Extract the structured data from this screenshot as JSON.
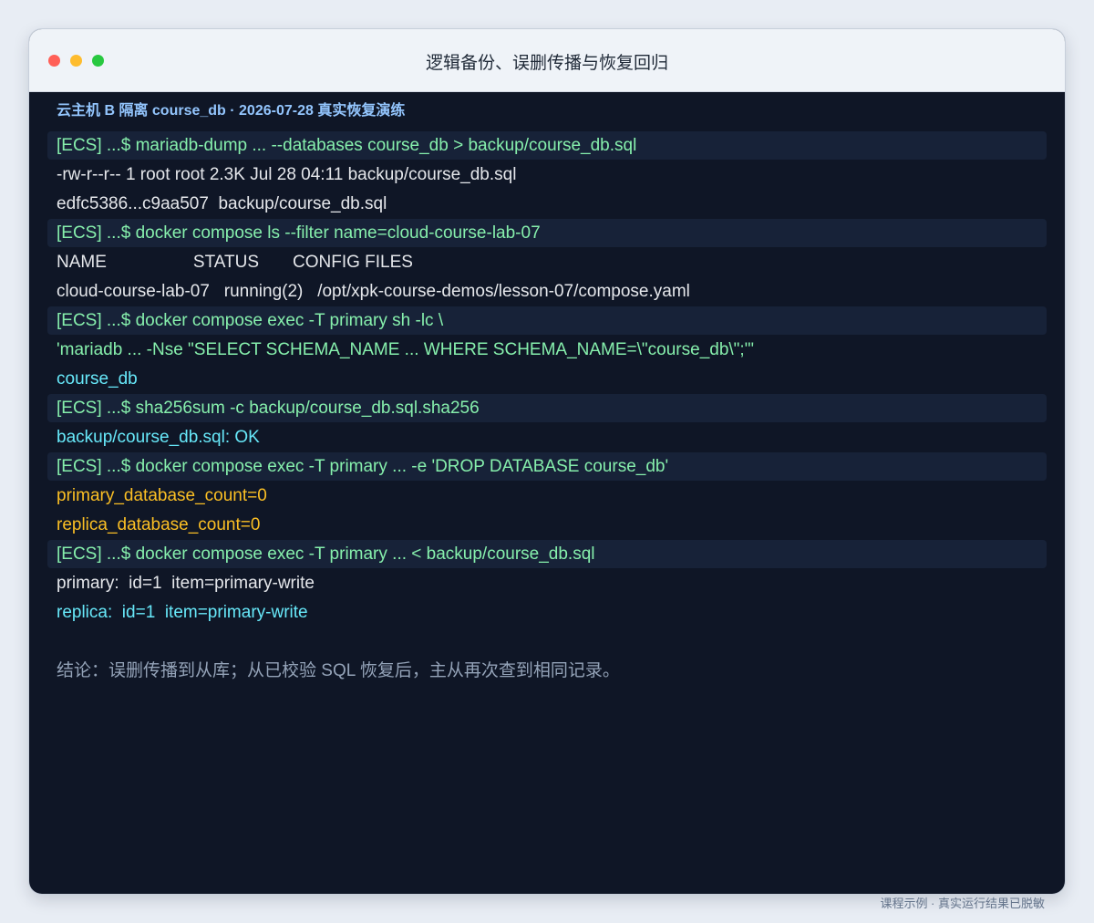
{
  "window": {
    "title": "逻辑备份、误删传播与恢复回归"
  },
  "terminal": {
    "header": "云主机 B 隔离 course_db · 2026-07-28 真实恢复演练",
    "lines": [
      {
        "kind": "cmd",
        "text": "[ECS] ...$ mariadb-dump ... --databases course_db > backup/course_db.sql"
      },
      {
        "kind": "white",
        "text": "-rw-r--r-- 1 root root 2.3K Jul 28 04:11 backup/course_db.sql"
      },
      {
        "kind": "white",
        "text": "edfc5386...c9aa507  backup/course_db.sql"
      },
      {
        "kind": "cmd",
        "text": "[ECS] ...$ docker compose ls --filter name=cloud-course-lab-07"
      },
      {
        "kind": "white",
        "text": "NAME                  STATUS       CONFIG FILES"
      },
      {
        "kind": "white",
        "text": "cloud-course-lab-07   running(2)   /opt/xpk-course-demos/lesson-07/compose.yaml"
      },
      {
        "kind": "cmd",
        "text": "[ECS] ...$ docker compose exec -T primary sh -lc \\"
      },
      {
        "kind": "green",
        "text": "'mariadb ... -Nse \"SELECT SCHEMA_NAME ... WHERE SCHEMA_NAME=\\\"course_db\\\";\"'"
      },
      {
        "kind": "cyan",
        "text": "course_db"
      },
      {
        "kind": "cmd",
        "text": "[ECS] ...$ sha256sum -c backup/course_db.sql.sha256"
      },
      {
        "kind": "cyan",
        "text": "backup/course_db.sql: OK"
      },
      {
        "kind": "cmd",
        "text": "[ECS] ...$ docker compose exec -T primary ... -e 'DROP DATABASE course_db'"
      },
      {
        "kind": "amber",
        "text": "primary_database_count=0"
      },
      {
        "kind": "amber",
        "text": "replica_database_count=0"
      },
      {
        "kind": "cmd",
        "text": "[ECS] ...$ docker compose exec -T primary ... < backup/course_db.sql"
      },
      {
        "kind": "white",
        "text": "primary:  id=1  item=primary-write"
      },
      {
        "kind": "cyan",
        "text": "replica:  id=1  item=primary-write"
      }
    ],
    "conclusion": "结论：误删传播到从库；从已校验 SQL 恢复后，主从再次查到相同记录。"
  },
  "footer": {
    "note": "课程示例 · 真实运行结果已脱敏"
  }
}
